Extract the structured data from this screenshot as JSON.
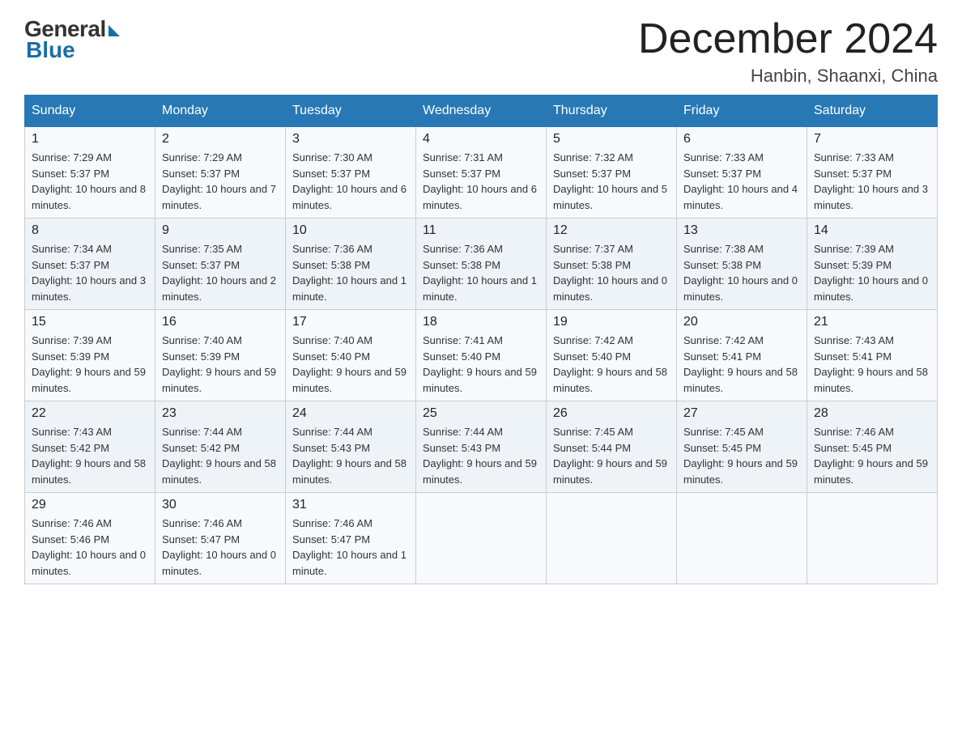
{
  "logo": {
    "general": "General",
    "blue": "Blue"
  },
  "title": "December 2024",
  "location": "Hanbin, Shaanxi, China",
  "days_of_week": [
    "Sunday",
    "Monday",
    "Tuesday",
    "Wednesday",
    "Thursday",
    "Friday",
    "Saturday"
  ],
  "weeks": [
    [
      {
        "day": "1",
        "sunrise": "7:29 AM",
        "sunset": "5:37 PM",
        "daylight": "10 hours and 8 minutes."
      },
      {
        "day": "2",
        "sunrise": "7:29 AM",
        "sunset": "5:37 PM",
        "daylight": "10 hours and 7 minutes."
      },
      {
        "day": "3",
        "sunrise": "7:30 AM",
        "sunset": "5:37 PM",
        "daylight": "10 hours and 6 minutes."
      },
      {
        "day": "4",
        "sunrise": "7:31 AM",
        "sunset": "5:37 PM",
        "daylight": "10 hours and 6 minutes."
      },
      {
        "day": "5",
        "sunrise": "7:32 AM",
        "sunset": "5:37 PM",
        "daylight": "10 hours and 5 minutes."
      },
      {
        "day": "6",
        "sunrise": "7:33 AM",
        "sunset": "5:37 PM",
        "daylight": "10 hours and 4 minutes."
      },
      {
        "day": "7",
        "sunrise": "7:33 AM",
        "sunset": "5:37 PM",
        "daylight": "10 hours and 3 minutes."
      }
    ],
    [
      {
        "day": "8",
        "sunrise": "7:34 AM",
        "sunset": "5:37 PM",
        "daylight": "10 hours and 3 minutes."
      },
      {
        "day": "9",
        "sunrise": "7:35 AM",
        "sunset": "5:37 PM",
        "daylight": "10 hours and 2 minutes."
      },
      {
        "day": "10",
        "sunrise": "7:36 AM",
        "sunset": "5:38 PM",
        "daylight": "10 hours and 1 minute."
      },
      {
        "day": "11",
        "sunrise": "7:36 AM",
        "sunset": "5:38 PM",
        "daylight": "10 hours and 1 minute."
      },
      {
        "day": "12",
        "sunrise": "7:37 AM",
        "sunset": "5:38 PM",
        "daylight": "10 hours and 0 minutes."
      },
      {
        "day": "13",
        "sunrise": "7:38 AM",
        "sunset": "5:38 PM",
        "daylight": "10 hours and 0 minutes."
      },
      {
        "day": "14",
        "sunrise": "7:39 AM",
        "sunset": "5:39 PM",
        "daylight": "10 hours and 0 minutes."
      }
    ],
    [
      {
        "day": "15",
        "sunrise": "7:39 AM",
        "sunset": "5:39 PM",
        "daylight": "9 hours and 59 minutes."
      },
      {
        "day": "16",
        "sunrise": "7:40 AM",
        "sunset": "5:39 PM",
        "daylight": "9 hours and 59 minutes."
      },
      {
        "day": "17",
        "sunrise": "7:40 AM",
        "sunset": "5:40 PM",
        "daylight": "9 hours and 59 minutes."
      },
      {
        "day": "18",
        "sunrise": "7:41 AM",
        "sunset": "5:40 PM",
        "daylight": "9 hours and 59 minutes."
      },
      {
        "day": "19",
        "sunrise": "7:42 AM",
        "sunset": "5:40 PM",
        "daylight": "9 hours and 58 minutes."
      },
      {
        "day": "20",
        "sunrise": "7:42 AM",
        "sunset": "5:41 PM",
        "daylight": "9 hours and 58 minutes."
      },
      {
        "day": "21",
        "sunrise": "7:43 AM",
        "sunset": "5:41 PM",
        "daylight": "9 hours and 58 minutes."
      }
    ],
    [
      {
        "day": "22",
        "sunrise": "7:43 AM",
        "sunset": "5:42 PM",
        "daylight": "9 hours and 58 minutes."
      },
      {
        "day": "23",
        "sunrise": "7:44 AM",
        "sunset": "5:42 PM",
        "daylight": "9 hours and 58 minutes."
      },
      {
        "day": "24",
        "sunrise": "7:44 AM",
        "sunset": "5:43 PM",
        "daylight": "9 hours and 58 minutes."
      },
      {
        "day": "25",
        "sunrise": "7:44 AM",
        "sunset": "5:43 PM",
        "daylight": "9 hours and 59 minutes."
      },
      {
        "day": "26",
        "sunrise": "7:45 AM",
        "sunset": "5:44 PM",
        "daylight": "9 hours and 59 minutes."
      },
      {
        "day": "27",
        "sunrise": "7:45 AM",
        "sunset": "5:45 PM",
        "daylight": "9 hours and 59 minutes."
      },
      {
        "day": "28",
        "sunrise": "7:46 AM",
        "sunset": "5:45 PM",
        "daylight": "9 hours and 59 minutes."
      }
    ],
    [
      {
        "day": "29",
        "sunrise": "7:46 AM",
        "sunset": "5:46 PM",
        "daylight": "10 hours and 0 minutes."
      },
      {
        "day": "30",
        "sunrise": "7:46 AM",
        "sunset": "5:47 PM",
        "daylight": "10 hours and 0 minutes."
      },
      {
        "day": "31",
        "sunrise": "7:46 AM",
        "sunset": "5:47 PM",
        "daylight": "10 hours and 1 minute."
      },
      null,
      null,
      null,
      null
    ]
  ]
}
